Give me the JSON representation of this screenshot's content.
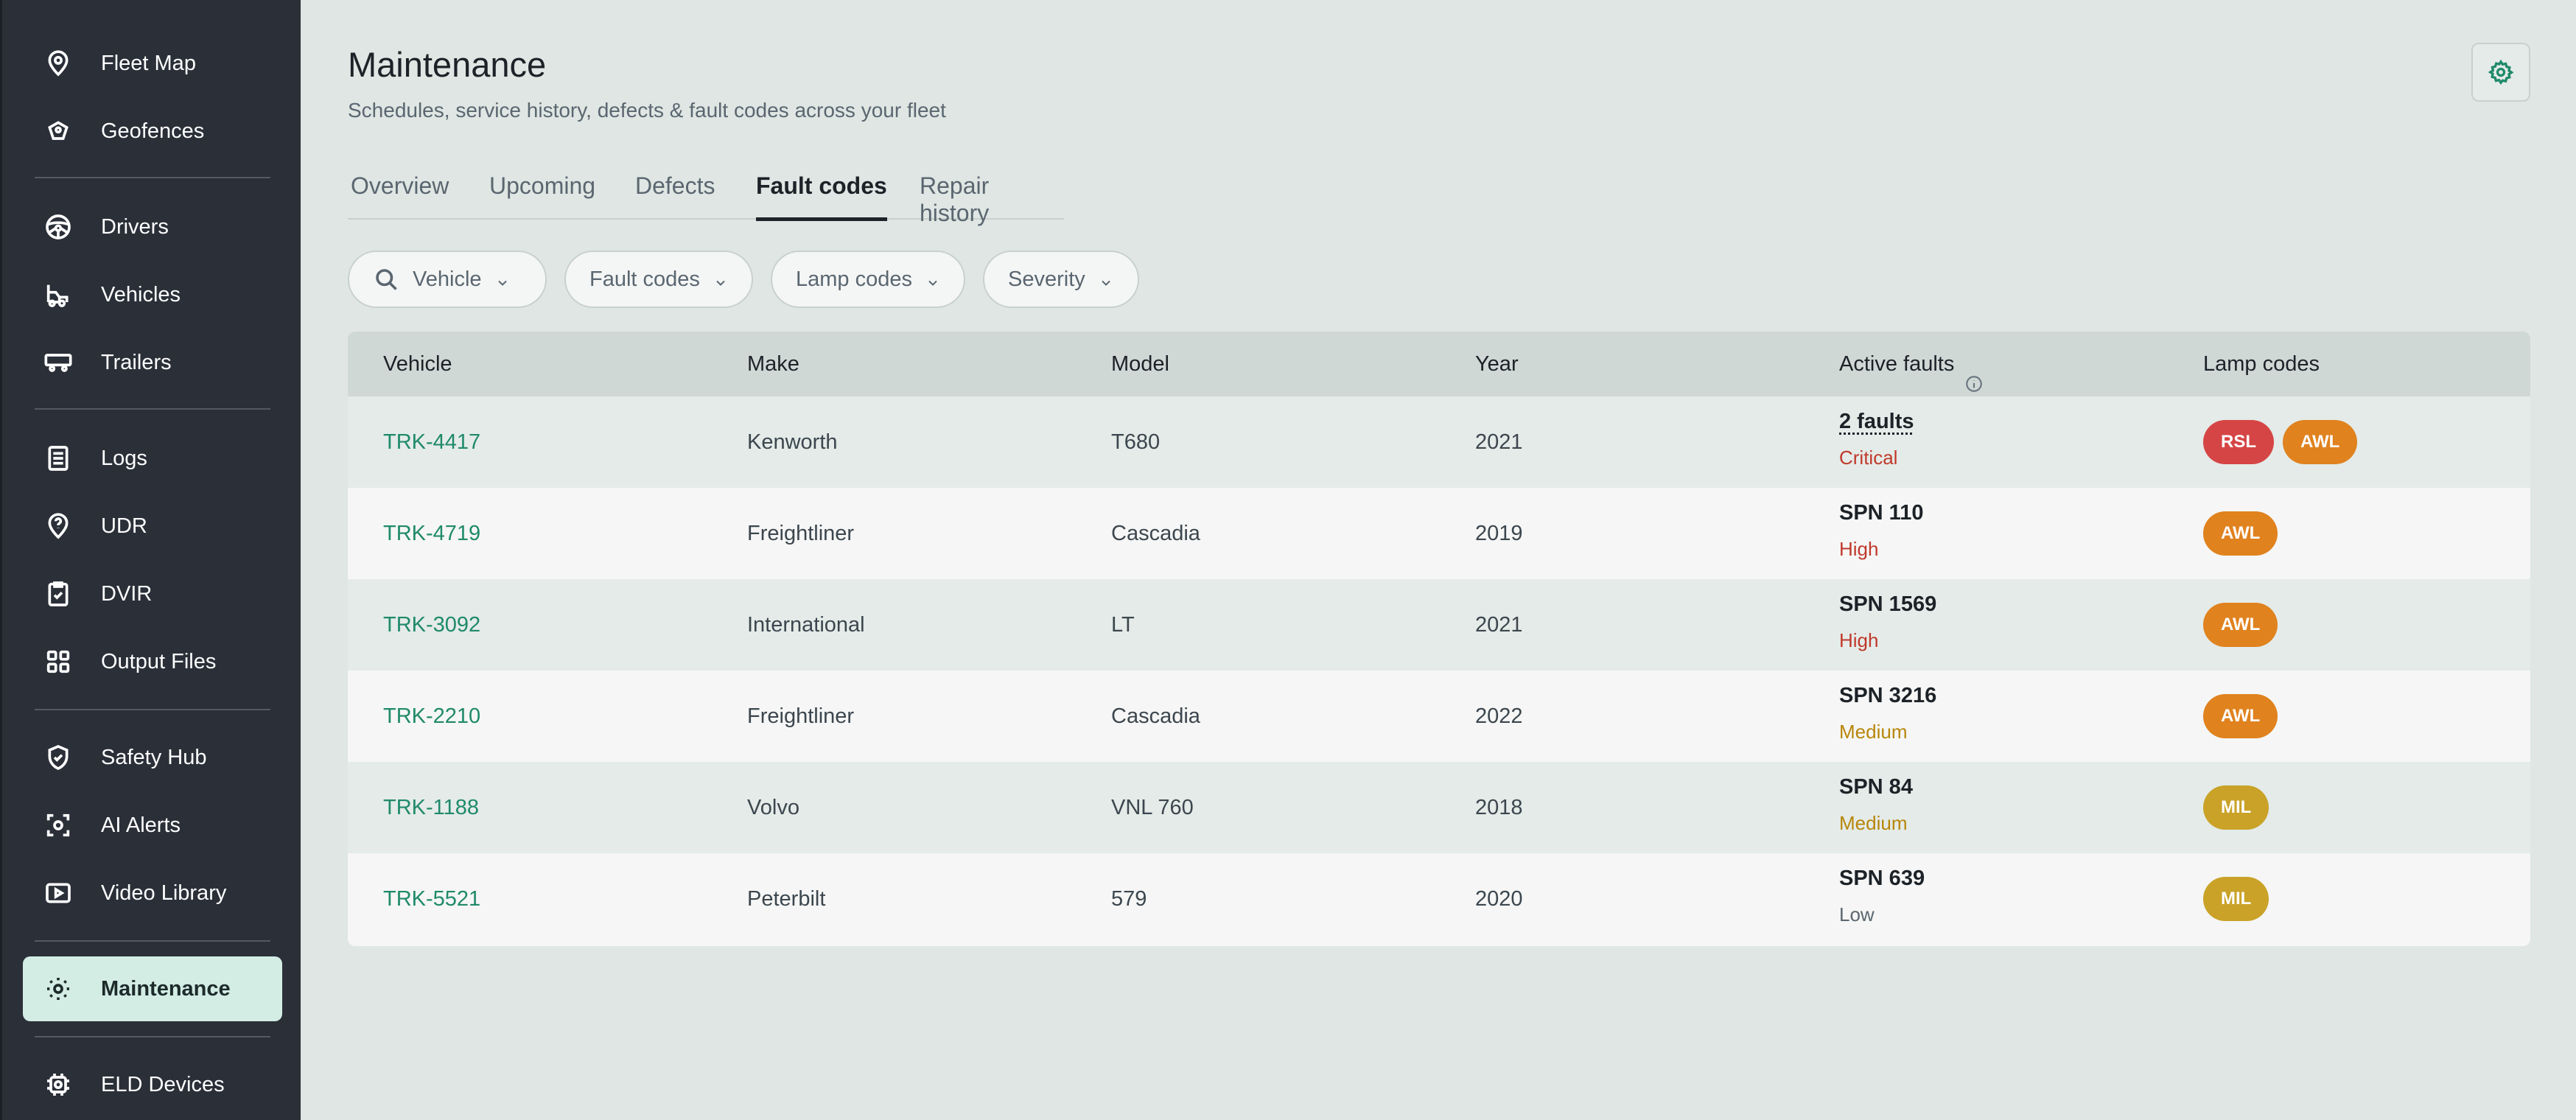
{
  "colors": {
    "sidebar_bg": "#2a2f38",
    "active_nav_bg": "#d3ede4",
    "accent": "#1f8a6a",
    "critical": "#c0392b",
    "high": "#c0392b",
    "medium": "#b8860b",
    "low": "#5a6670",
    "lamp_rsl": "#d64545",
    "lamp_awl": "#e0821e",
    "lamp_mil": "#c9a227"
  },
  "sidebar": {
    "items": [
      {
        "label": "Fleet Map",
        "icon": "map-pin-icon"
      },
      {
        "label": "Geofences",
        "icon": "geofence-icon"
      },
      {
        "label": "Drivers",
        "icon": "steering-wheel-icon"
      },
      {
        "label": "Vehicles",
        "icon": "vehicle-icon"
      },
      {
        "label": "Trailers",
        "icon": "trailer-icon"
      },
      {
        "label": "Logs",
        "icon": "logs-icon"
      },
      {
        "label": "UDR",
        "icon": "question-pin-icon"
      },
      {
        "label": "DVIR",
        "icon": "clipboard-check-icon"
      },
      {
        "label": "Output Files",
        "icon": "grid-icon"
      },
      {
        "label": "Safety Hub",
        "icon": "shield-check-icon"
      },
      {
        "label": "AI Alerts",
        "icon": "ai-scan-icon"
      },
      {
        "label": "Video Library",
        "icon": "play-icon"
      },
      {
        "label": "Maintenance",
        "icon": "wrench-gear-icon",
        "active": true
      },
      {
        "label": "ELD Devices",
        "icon": "device-icon"
      }
    ]
  },
  "header": {
    "title": "Maintenance",
    "subtitle": "Schedules, service history, defects & fault codes across your fleet",
    "settings_icon": "gear-icon"
  },
  "tabs": [
    {
      "label": "Overview"
    },
    {
      "label": "Upcoming"
    },
    {
      "label": "Defects"
    },
    {
      "label": "Fault codes",
      "active": true
    },
    {
      "label": "Repair history"
    }
  ],
  "filters": [
    {
      "label": "Vehicle",
      "icon": "search-icon"
    },
    {
      "label": "Fault codes"
    },
    {
      "label": "Lamp codes"
    },
    {
      "label": "Severity"
    }
  ],
  "table": {
    "columns": [
      "Vehicle",
      "Make",
      "Model",
      "Year",
      "Active faults",
      "Lamp codes"
    ],
    "rows": [
      {
        "vehicle": "TRK-4417",
        "make": "Kenworth",
        "model": "T680",
        "year": "2021",
        "fault": "2 faults",
        "severity": "Critical",
        "lamps": [
          "RSL",
          "AWL"
        ]
      },
      {
        "vehicle": "TRK-4719",
        "make": "Freightliner",
        "model": "Cascadia",
        "year": "2019",
        "fault": "SPN 110",
        "severity": "High",
        "lamps": [
          "AWL"
        ]
      },
      {
        "vehicle": "TRK-3092",
        "make": "International",
        "model": "LT",
        "year": "2021",
        "fault": "SPN 1569",
        "severity": "High",
        "lamps": [
          "AWL"
        ]
      },
      {
        "vehicle": "TRK-2210",
        "make": "Freightliner",
        "model": "Cascadia",
        "year": "2022",
        "fault": "SPN 3216",
        "severity": "Medium",
        "lamps": [
          "AWL"
        ]
      },
      {
        "vehicle": "TRK-1188",
        "make": "Volvo",
        "model": "VNL 760",
        "year": "2018",
        "fault": "SPN 84",
        "severity": "Medium",
        "lamps": [
          "MIL"
        ]
      },
      {
        "vehicle": "TRK-5521",
        "make": "Peterbilt",
        "model": "579",
        "year": "2020",
        "fault": "SPN 639",
        "severity": "Low",
        "lamps": [
          "MIL"
        ]
      }
    ]
  }
}
